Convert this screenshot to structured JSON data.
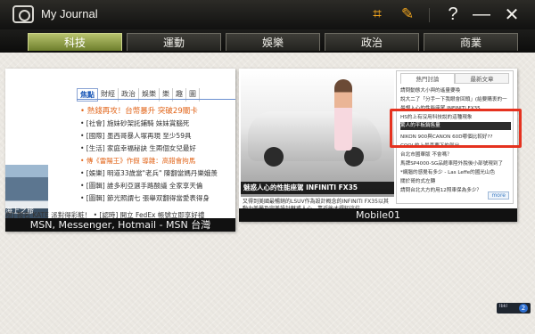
{
  "app": {
    "title": "My Journal"
  },
  "toolbar": {
    "crop_glyph": "⌗",
    "edit_glyph": "✎",
    "help_glyph": "?",
    "minimize_glyph": "—",
    "close_glyph": "✕"
  },
  "tabs": [
    {
      "label": "科技"
    },
    {
      "label": "運動"
    },
    {
      "label": "娛樂"
    },
    {
      "label": "政治"
    },
    {
      "label": "商業"
    }
  ],
  "cards": [
    {
      "caption": "MSN, Messenger, Hotmail - MSN 台灣",
      "nav": [
        "焦點",
        "財經",
        "政治",
        "娛樂",
        "樂",
        "趣",
        "圖"
      ],
      "headline": "• 熱錢再攻！台幣暴升 突破29關卡",
      "items": [
        "• [社會] 施妹砂架託鋪騎 妹妹賞腦死",
        "• [國際] 墨西哥暴人塚再現 至少59具",
        "• [生活] 家庭幸福秘訣 生兩個女兒最好",
        "• 傳《雷陽王》作假 導雜：高錯會拘馬",
        "• [娛樂] 明道33歲當\"老兵\" 陳翻當媽丹樂娥羨",
        "• [圖輯] 誰多利亞選手路酸議 全家享天倫",
        "• [圖輯] 節光照謂七 張舉双翻得當愛表得身"
      ],
      "ship_text": "海上之旅",
      "bottom_text": "樹] 報名 KATE 派對得彩粧！ • [認時] 開立 FedEx 帳號立即享好禮"
    },
    {
      "caption": "Mobile01",
      "banner": "魅惑人心的性能座駕 INFINITI FX35",
      "desc": "又得到美國最暢銷的LSUV作為設計概念的INFINITI FX35以其動力美學及完美設計魅惑人心，靠近後才得知這位...",
      "panel_tabs": [
        "熱門討論",
        "最新文章"
      ],
      "panel_rows": [
        "請問動態大小與的遙量要喚",
        "說大二了「分手一下我眼會回頭」(給要購衷的一",
        "最想入心的性能座駕 INFINITI FX35",
        "HS的上有沒用科技說的這種現象",
        "驚人的平板銷售量",
        "NIKON 900與CANON 60D哪個比較好??",
        "COOL的上最喜要下的部分",
        "台北市國華版 不會嗎？",
        "馬牌SP4000-SG品館車陸外脫後小部號現到了",
        "*網腦的感覺有多少 - Las Leffe的國光山色",
        "關於哥的式左轉",
        "請問台北大方的用12照車保為多少？"
      ],
      "highlight_index": 4,
      "more_label": "more"
    }
  ],
  "tray": {
    "label": "Ibkl",
    "badge": "2"
  }
}
